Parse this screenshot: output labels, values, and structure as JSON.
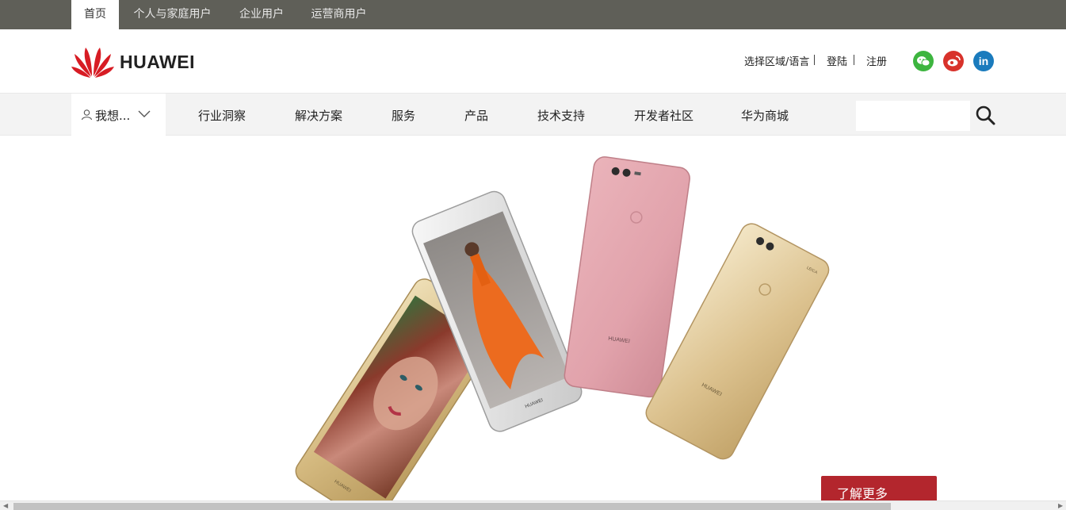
{
  "topbar": {
    "tabs": [
      {
        "label": "首页",
        "active": true
      },
      {
        "label": "个人与家庭用户",
        "active": false
      },
      {
        "label": "企业用户",
        "active": false
      },
      {
        "label": "运营商用户",
        "active": false
      }
    ]
  },
  "header": {
    "brand": "HUAWEI",
    "region_language": "选择区域/语言",
    "login": "登陆",
    "register": "注册",
    "social": [
      {
        "icon": "wechat-icon",
        "color": "#3db53f"
      },
      {
        "icon": "weibo-icon",
        "color": "#d8322b"
      },
      {
        "icon": "linkedin-icon",
        "color": "#1a7bbd",
        "text": "in"
      }
    ]
  },
  "nav": {
    "want_label": "我想...",
    "items": [
      "行业洞察",
      "解决方案",
      "服务",
      "产品",
      "技术支持",
      "开发者社区",
      "华为商城"
    ],
    "search_placeholder": ""
  },
  "side_tools": [
    {
      "icon": "chat-icon"
    },
    {
      "icon": "mail-icon"
    },
    {
      "icon": "phone-icon"
    }
  ],
  "hero": {
    "phone_screen_brand": "HUAWEI",
    "phone_camera_brand": "LEICA",
    "more_button": "了解更多"
  },
  "colors": {
    "topbar": "#5f5f58",
    "nav_bg": "#f3f3f3",
    "accent_red": "#b3262d",
    "side_tool_bg": "#d9d9d9"
  }
}
